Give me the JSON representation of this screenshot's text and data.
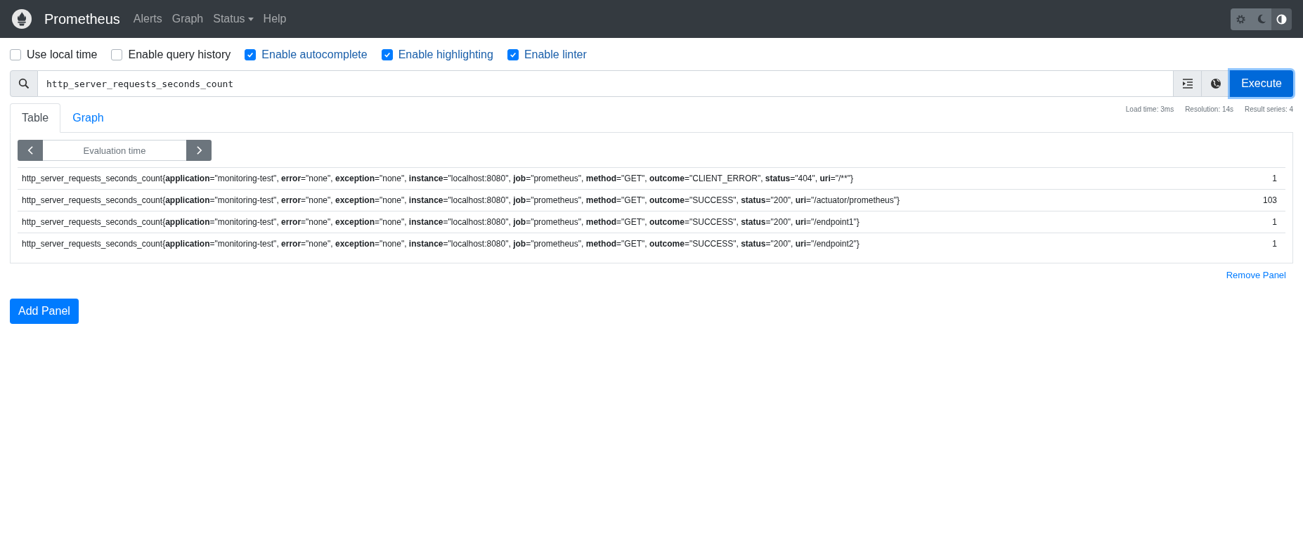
{
  "navbar": {
    "brand": "Prometheus",
    "links": [
      {
        "label": "Alerts",
        "dropdown": false
      },
      {
        "label": "Graph",
        "dropdown": false
      },
      {
        "label": "Status",
        "dropdown": true
      },
      {
        "label": "Help",
        "dropdown": false
      }
    ],
    "theme_buttons": [
      {
        "kind": "light",
        "selected": false
      },
      {
        "kind": "dark",
        "selected": false
      },
      {
        "kind": "auto",
        "selected": true
      }
    ]
  },
  "options": [
    {
      "label": "Use local time",
      "checked": false
    },
    {
      "label": "Enable query history",
      "checked": false
    },
    {
      "label": "Enable autocomplete",
      "checked": true
    },
    {
      "label": "Enable highlighting",
      "checked": true
    },
    {
      "label": "Enable linter",
      "checked": true
    }
  ],
  "query": {
    "value": "http_server_requests_seconds_count",
    "execute": "Execute"
  },
  "stats": [
    "Load time: 3ms",
    "Resolution: 14s",
    "Result series: 4"
  ],
  "tabs": [
    {
      "label": "Table",
      "selected": true
    },
    {
      "label": "Graph",
      "selected": false
    }
  ],
  "evaluation_time": {
    "placeholder": "Evaluation time"
  },
  "rows": [
    {
      "series": "http_server_requests_seconds_count{**application**=\"monitoring-test\", **error**=\"none\", **exception**=\"none\", **instance**=\"localhost:8080\", **job**=\"prometheus\", **method**=\"GET\", **outcome**=\"CLIENT_ERROR\", **status**=\"404\", **uri**=\"/**\"}",
      "value": "1"
    },
    {
      "series": "http_server_requests_seconds_count{**application**=\"monitoring-test\", **error**=\"none\", **exception**=\"none\", **instance**=\"localhost:8080\", **job**=\"prometheus\", **method**=\"GET\", **outcome**=\"SUCCESS\", **status**=\"200\", **uri**=\"/actuator/prometheus\"}",
      "value": "103"
    },
    {
      "series": "http_server_requests_seconds_count{**application**=\"monitoring-test\", **error**=\"none\", **exception**=\"none\", **instance**=\"localhost:8080\", **job**=\"prometheus\", **method**=\"GET\", **outcome**=\"SUCCESS\", **status**=\"200\", **uri**=\"/endpoint1\"}",
      "value": "1"
    },
    {
      "series": "http_server_requests_seconds_count{**application**=\"monitoring-test\", **error**=\"none\", **exception**=\"none\", **instance**=\"localhost:8080\", **job**=\"prometheus\", **method**=\"GET\", **outcome**=\"SUCCESS\", **status**=\"200\", **uri**=\"/endpoint2\"}",
      "value": "1"
    }
  ],
  "remove_panel": "Remove Panel",
  "add_panel": "Add Panel"
}
